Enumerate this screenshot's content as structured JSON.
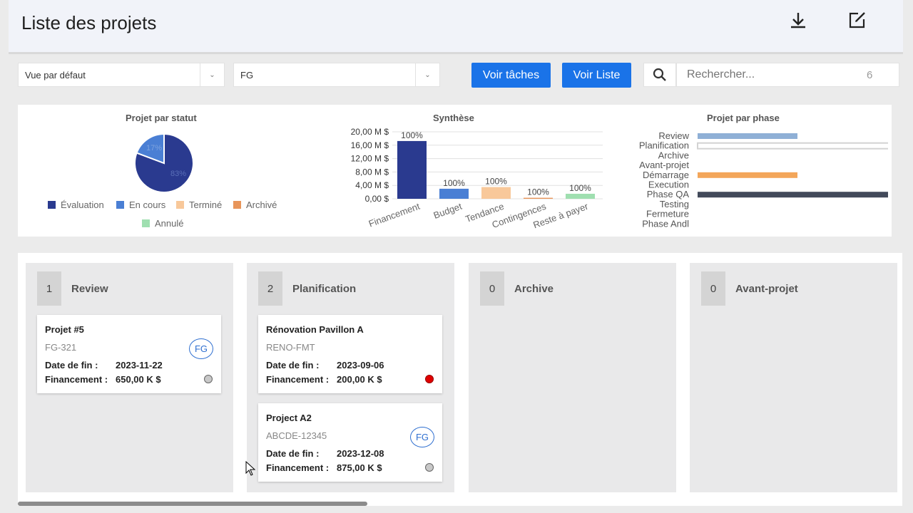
{
  "header": {
    "title": "Liste des projets",
    "icons": [
      "download-icon",
      "edit-icon"
    ]
  },
  "toolbar": {
    "view_select": "Vue par défaut",
    "filter_select": "FG",
    "btn_tasks": "Voir tâches",
    "btn_list": "Voir Liste",
    "search_placeholder": "Rechercher...",
    "count": "6"
  },
  "charts": {
    "status": {
      "title": "Projet par statut",
      "labels": [
        "17%",
        "83%"
      ],
      "legend": [
        "Évaluation",
        "En cours",
        "Terminé",
        "Archivé",
        "Annulé"
      ]
    },
    "synthese": {
      "title": "Synthèse"
    },
    "phase": {
      "title": "Projet par phase"
    }
  },
  "chart_data": [
    {
      "type": "pie",
      "title": "Projet par statut",
      "labels": [
        "Évaluation",
        "En cours",
        "Terminé",
        "Archivé",
        "Annulé"
      ],
      "values": [
        83,
        17,
        0,
        0,
        0
      ],
      "colors": [
        "#2a3a8f",
        "#4a7fd4",
        "#f8c89a",
        "#e8955a",
        "#9fdfb0"
      ],
      "legend": "bottom"
    },
    {
      "type": "bar",
      "title": "Synthèse",
      "categories": [
        "Financement",
        "Budget",
        "Tendance",
        "Contingences",
        "Reste à payer"
      ],
      "values": [
        17.25,
        3.0,
        3.5,
        0.3,
        1.5
      ],
      "data_labels": [
        "100%",
        "100%",
        "100%",
        "100%",
        "100%"
      ],
      "colors": [
        "#2a3a8f",
        "#4a7fd4",
        "#f8c89a",
        "#e8955a",
        "#9fdfb0"
      ],
      "ylim": [
        0,
        20
      ],
      "yticks": [
        "0,00 $",
        "4,00 M $",
        "8,00 M $",
        "12,00 M $",
        "16,00 M $",
        "20,00 M $"
      ],
      "ytick_values": [
        0,
        4,
        8,
        12,
        16,
        20
      ],
      "grid": true
    },
    {
      "type": "bar",
      "orientation": "horizontal",
      "title": "Projet par phase",
      "categories": [
        "Review",
        "Planification",
        "Archive",
        "Avant-projet",
        "Démarrage",
        "Execution",
        "Phase QA",
        "Testing",
        "Fermeture",
        "Phase Andl"
      ],
      "values": [
        1,
        2,
        0,
        0,
        1,
        0,
        2,
        0,
        0,
        0
      ],
      "colors": [
        "#8fb0d6",
        "#d3d3d3",
        "#cccccc",
        "#cccccc",
        "#f3a65a",
        "#cccccc",
        "#424a5a",
        "#cccccc",
        "#cccccc",
        "#cccccc"
      ],
      "xlim": [
        0,
        2
      ]
    }
  ],
  "board": {
    "columns": [
      {
        "count": "1",
        "name": "Review",
        "cards": [
          {
            "name": "Projet #5",
            "code": "FG-321",
            "date_label": "Date de fin :",
            "date": "2023-11-22",
            "fin_label": "Financement :",
            "fin": "650,00 K $",
            "badge": "FG",
            "status_color": "#c8c8c8"
          }
        ]
      },
      {
        "count": "2",
        "name": "Planification",
        "cards": [
          {
            "name": "Rénovation Pavillon A",
            "code": "RENO-FMT",
            "date_label": "Date de fin :",
            "date": "2023-09-06",
            "fin_label": "Financement :",
            "fin": "200,00 K $",
            "badge": "",
            "status_color": "#e00000"
          },
          {
            "name": "Project A2",
            "code": "ABCDE-12345",
            "date_label": "Date de fin :",
            "date": "2023-12-08",
            "fin_label": "Financement :",
            "fin": "875,00 K $",
            "badge": "FG",
            "status_color": "#c8c8c8"
          }
        ]
      },
      {
        "count": "0",
        "name": "Archive",
        "cards": []
      },
      {
        "count": "0",
        "name": "Avant-projet",
        "cards": []
      }
    ]
  }
}
